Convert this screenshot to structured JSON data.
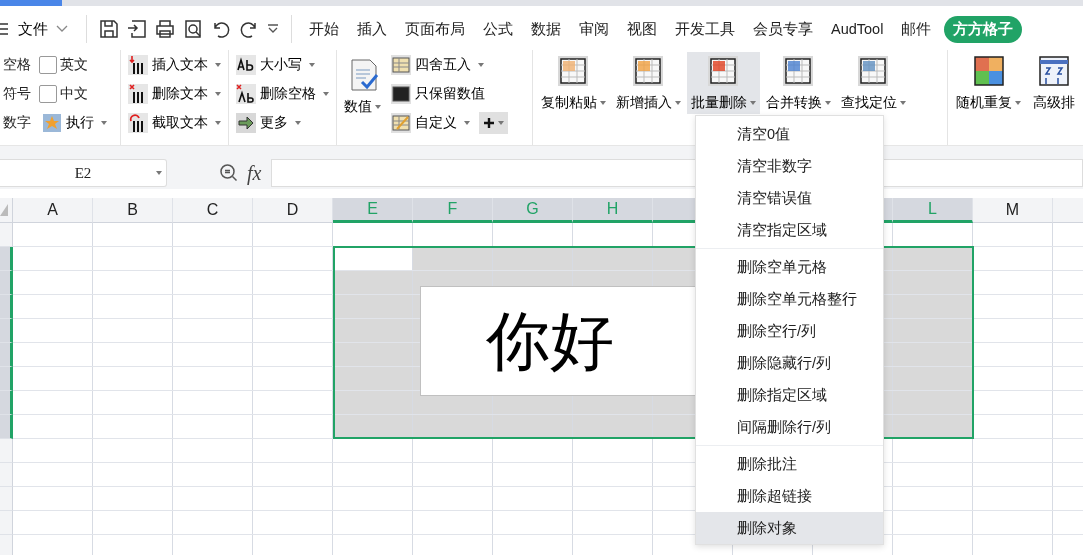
{
  "menu_bar": {
    "file_menu": "文件",
    "tabs": [
      {
        "label": "开始",
        "selected": false
      },
      {
        "label": "插入",
        "selected": false
      },
      {
        "label": "页面布局",
        "selected": false
      },
      {
        "label": "公式",
        "selected": false
      },
      {
        "label": "数据",
        "selected": false
      },
      {
        "label": "审阅",
        "selected": false
      },
      {
        "label": "视图",
        "selected": false
      },
      {
        "label": "开发工具",
        "selected": false
      },
      {
        "label": "会员专享",
        "selected": false
      },
      {
        "label": "AudTool",
        "selected": false
      },
      {
        "label": "邮件",
        "selected": false
      },
      {
        "label": "方方格子",
        "selected": true
      }
    ]
  },
  "ribbon": {
    "labels": [
      "空格",
      "符号",
      "数字"
    ],
    "checkboxes": [
      {
        "label": "英文",
        "checked": false
      },
      {
        "label": "中文",
        "checked": false
      }
    ],
    "execute": "执行",
    "text_tools": [
      {
        "kind": "insert",
        "label": "插入文本"
      },
      {
        "kind": "delete",
        "label": "删除文本"
      },
      {
        "kind": "cut",
        "label": "截取文本"
      }
    ],
    "case_tools": [
      {
        "kind": "case",
        "label": "大小写"
      },
      {
        "kind": "space",
        "label": "删除空格"
      },
      {
        "kind": "more",
        "label": "更多"
      }
    ],
    "number_button": "数值",
    "number_tools": [
      {
        "kind": "round",
        "label": "四舍五入",
        "dropdown": true
      },
      {
        "kind": "keep",
        "label": "只保留数值",
        "dropdown": false
      },
      {
        "kind": "custom",
        "label": "自定义",
        "dropdown": true
      }
    ],
    "big_buttons": [
      {
        "kind": "paste",
        "label": "复制粘贴",
        "selected": false
      },
      {
        "kind": "insert",
        "label": "新增插入",
        "selected": false
      },
      {
        "kind": "delete",
        "label": "批量删除",
        "selected": true
      },
      {
        "kind": "merge",
        "label": "合并转换",
        "selected": false
      },
      {
        "kind": "find",
        "label": "查找定位",
        "selected": false
      }
    ],
    "more_buttons": [
      {
        "kind": "random",
        "label": "随机重复",
        "dropdown": true
      },
      {
        "kind": "sort",
        "label": "高级排",
        "dropdown": false
      }
    ]
  },
  "formula_bar": {
    "name_box": "E2",
    "fx": "fx"
  },
  "sheet": {
    "columns": [
      {
        "label": "A",
        "selected": false
      },
      {
        "label": "B",
        "selected": false
      },
      {
        "label": "C",
        "selected": false
      },
      {
        "label": "D",
        "selected": false
      },
      {
        "label": "E",
        "selected": true
      },
      {
        "label": "F",
        "selected": true
      },
      {
        "label": "G",
        "selected": true
      },
      {
        "label": "H",
        "selected": true
      },
      {
        "selected": true
      },
      {},
      {
        "selected": true
      },
      {
        "label": "L",
        "selected": true
      },
      {
        "label": "M",
        "selected": false
      }
    ],
    "rows": [
      {
        "selected": false
      },
      {
        "selected": true
      },
      {
        "selected": true
      },
      {
        "selected": true
      },
      {
        "selected": true
      },
      {
        "selected": true
      },
      {
        "selected": true
      },
      {
        "selected": true
      },
      {
        "selected": true
      },
      {
        "selected": false
      },
      {
        "selected": false
      },
      {
        "selected": false
      },
      {
        "selected": false
      },
      {
        "selected": false
      }
    ],
    "text_object": "你好"
  },
  "dropdown_menu": [
    [
      {
        "label": "清空0值",
        "selected": false
      },
      {
        "label": "清空非数字",
        "selected": false
      },
      {
        "label": "清空错误值",
        "selected": false
      },
      {
        "label": "清空指定区域",
        "selected": false
      }
    ],
    [
      {
        "label": "删除空单元格",
        "selected": false
      },
      {
        "label": "删除空单元格整行",
        "selected": false
      },
      {
        "label": "删除空行/列",
        "selected": false
      },
      {
        "label": "删除隐藏行/列",
        "selected": false
      },
      {
        "label": "删除指定区域",
        "selected": false
      },
      {
        "label": "间隔删除行/列",
        "selected": false
      }
    ],
    [
      {
        "label": "删除批注",
        "selected": false
      },
      {
        "label": "删除超链接",
        "selected": false
      },
      {
        "label": "删除对象",
        "selected": true
      }
    ]
  ]
}
